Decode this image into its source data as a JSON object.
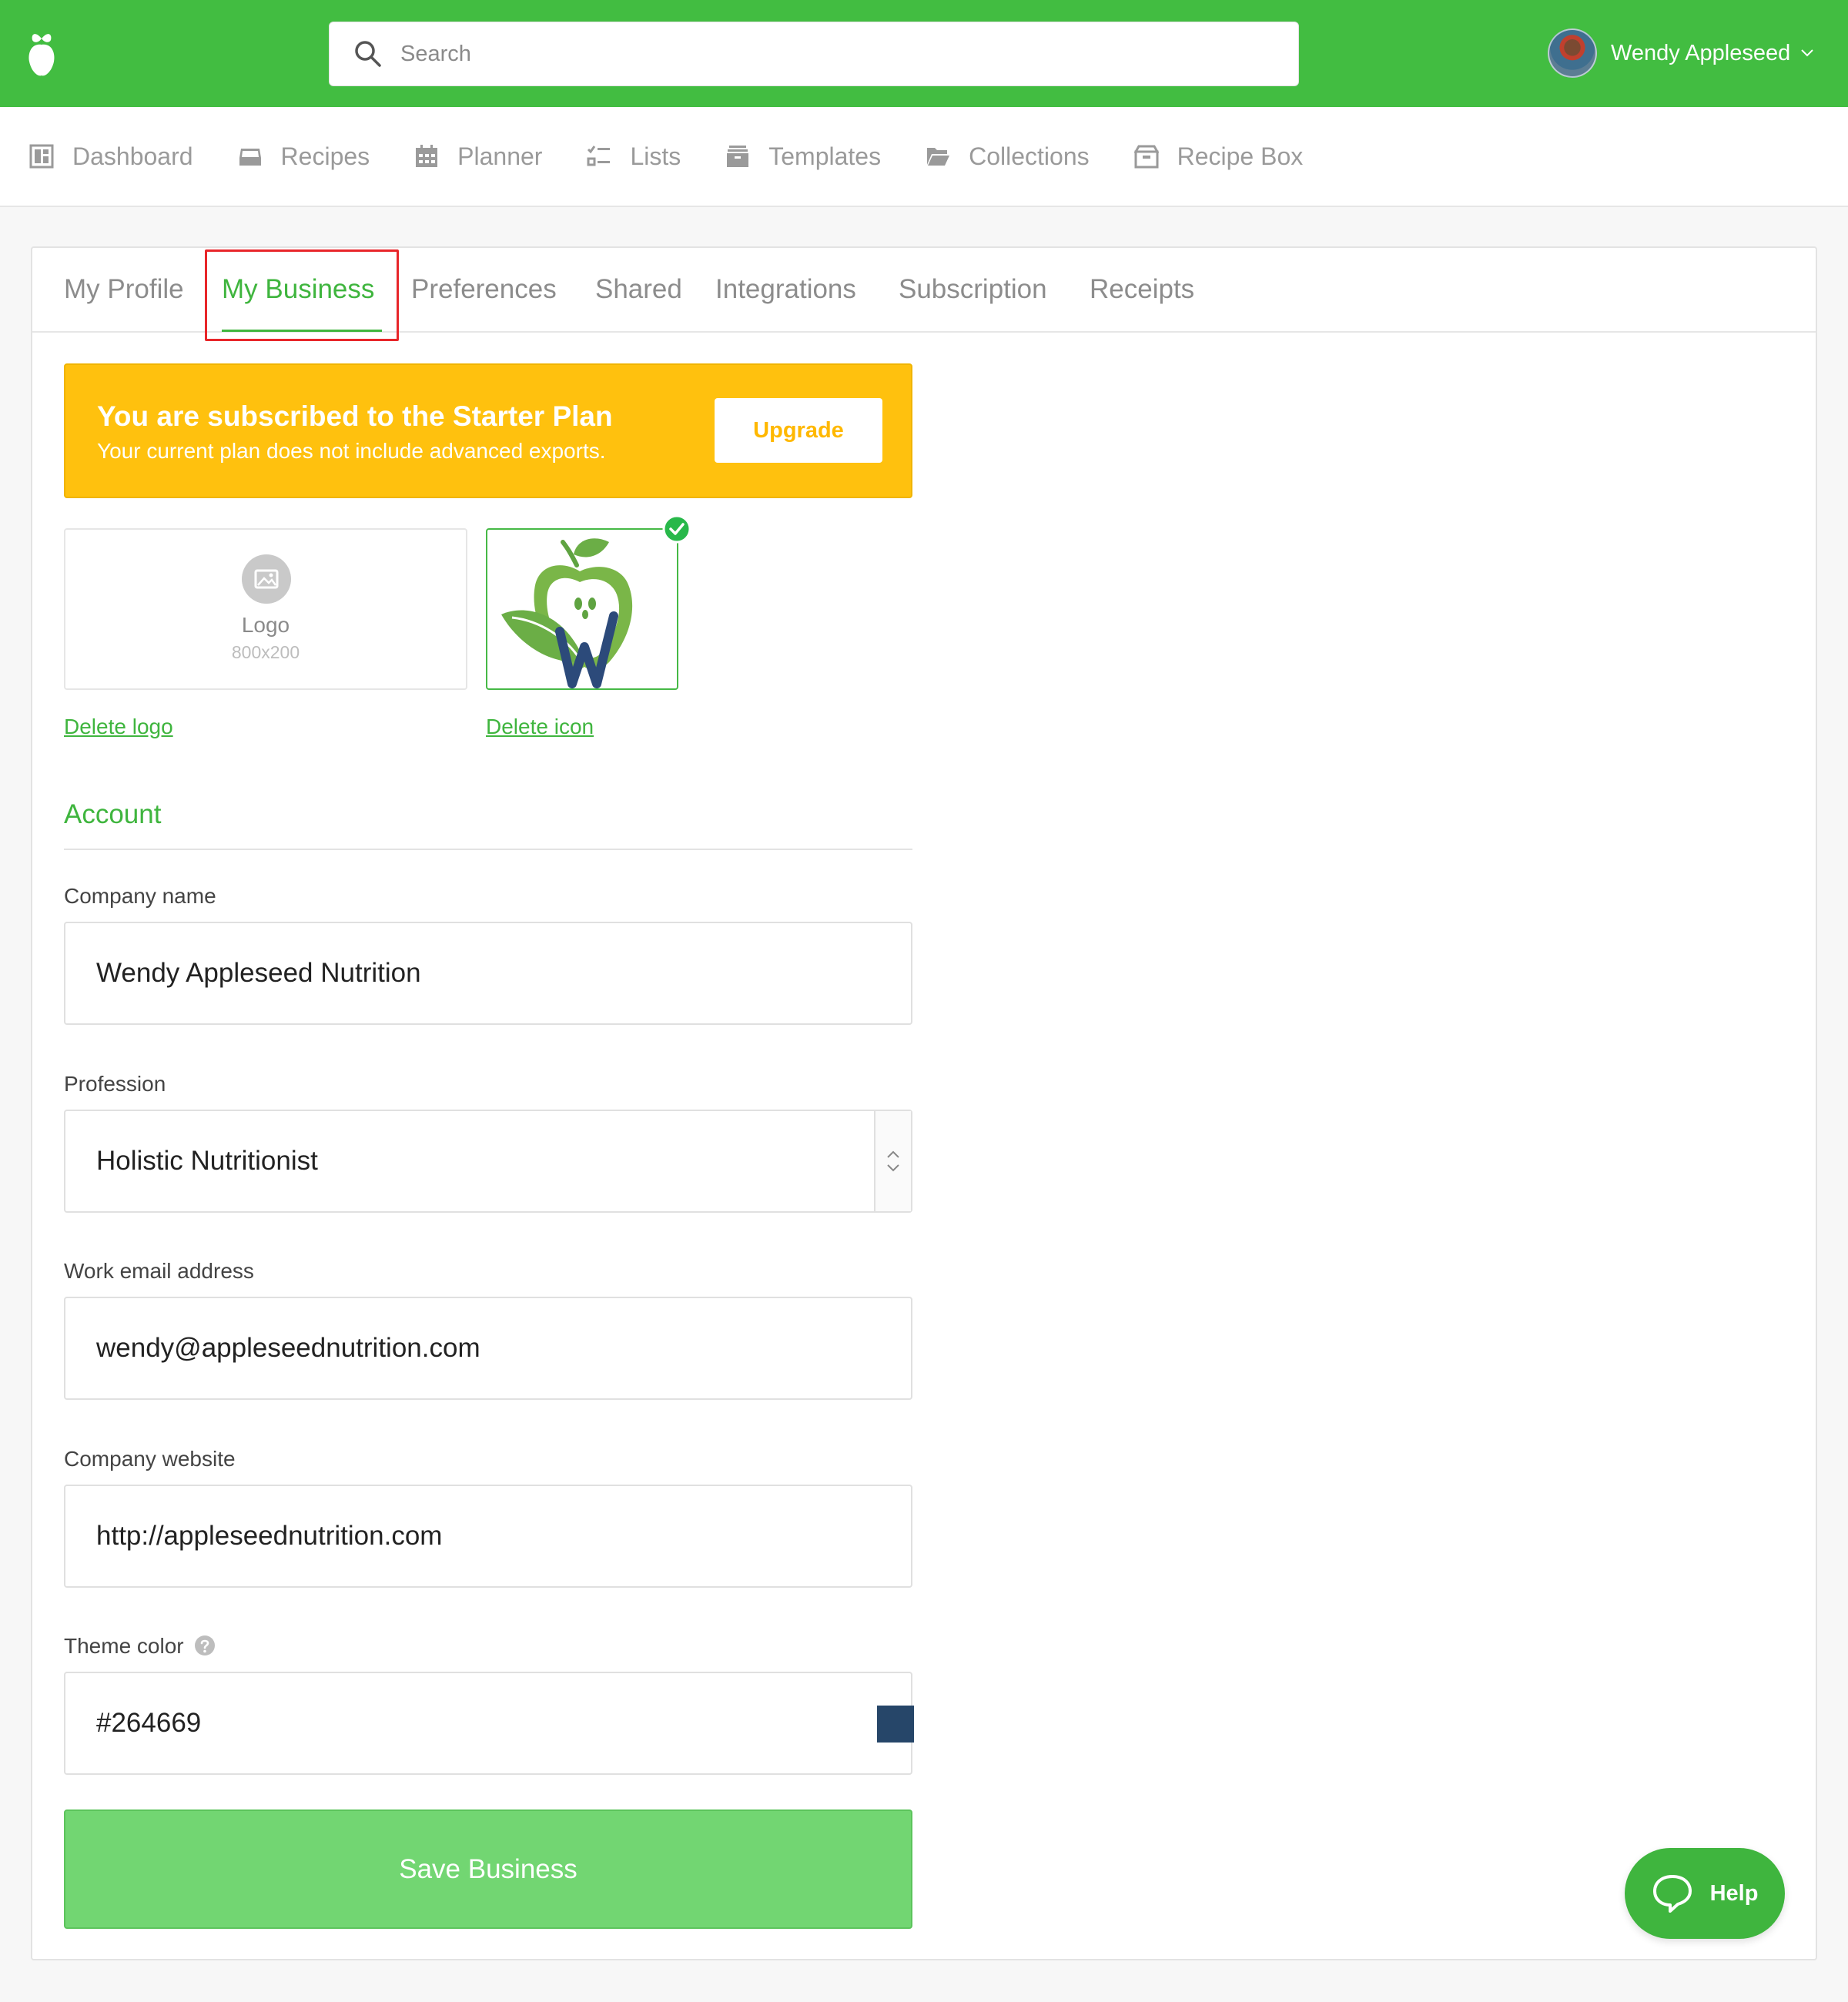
{
  "header": {
    "search_placeholder": "Search",
    "user_name": "Wendy Appleseed",
    "brand_color": "#42bd41"
  },
  "nav": {
    "items": [
      {
        "label": "Dashboard",
        "icon": "dashboard-icon"
      },
      {
        "label": "Recipes",
        "icon": "inbox-icon"
      },
      {
        "label": "Planner",
        "icon": "calendar-icon"
      },
      {
        "label": "Lists",
        "icon": "checklist-icon"
      },
      {
        "label": "Templates",
        "icon": "archive-icon"
      },
      {
        "label": "Collections",
        "icon": "folder-icon"
      },
      {
        "label": "Recipe Box",
        "icon": "box-icon"
      }
    ]
  },
  "tabs": [
    {
      "label": "My Profile"
    },
    {
      "label": "My Business",
      "active": true
    },
    {
      "label": "Preferences"
    },
    {
      "label": "Shared"
    },
    {
      "label": "Integrations"
    },
    {
      "label": "Subscription"
    },
    {
      "label": "Receipts"
    }
  ],
  "banner": {
    "title": "You are subscribed to the Starter Plan",
    "subtitle": "Your current plan does not include advanced exports.",
    "upgrade_label": "Upgrade",
    "color": "#ffc10e"
  },
  "branding": {
    "logo_label": "Logo",
    "logo_size": "800x200",
    "delete_logo": "Delete logo",
    "delete_icon": "Delete icon"
  },
  "account": {
    "section_title": "Account",
    "company_name": {
      "label": "Company name",
      "value": "Wendy Appleseed Nutrition"
    },
    "profession": {
      "label": "Profession",
      "value": "Holistic Nutritionist"
    },
    "work_email": {
      "label": "Work email address",
      "value": "wendy@appleseednutrition.com"
    },
    "website": {
      "label": "Company website",
      "value": "http://appleseednutrition.com"
    },
    "theme_color": {
      "label": "Theme color",
      "value": "#264669"
    },
    "save_label": "Save Business"
  },
  "help": {
    "label": "Help"
  }
}
